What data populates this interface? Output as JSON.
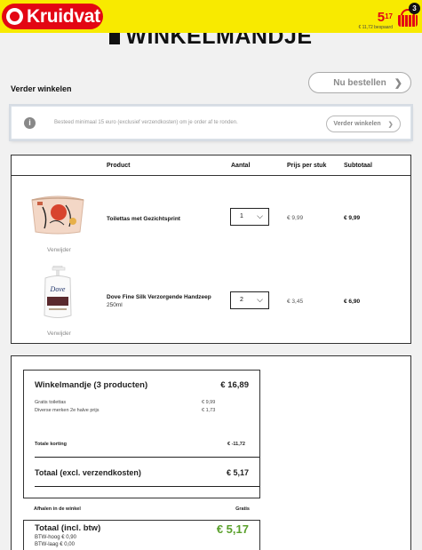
{
  "header": {
    "logo_text": "Kruidvat",
    "price_main": "5",
    "price_cents": "17",
    "saved_text": "€ 11,72 bespaard",
    "basket_count": "3",
    "brand_red": "#e30613",
    "brand_yellow": "#f8ea00"
  },
  "page": {
    "title": "WINKELMANDJE",
    "continue_label": "Verder winkelen",
    "order_button": "Nu bestellen"
  },
  "notice": {
    "text": "Besteed minimaal 15 euro (exclusief verzendkosten) om je order af te ronden.",
    "button": "Verder winkelen"
  },
  "table": {
    "headers": [
      "Product",
      "Aantal",
      "Prijs per stuk",
      "Subtotaal"
    ],
    "rows": [
      {
        "name": "Toilettas met Gezichtsprint",
        "subtitle": "",
        "qty": "1",
        "unit_price": "€ 9,99",
        "subtotal": "€ 9,99",
        "remove": "Verwijder"
      },
      {
        "name": "Dove Fine Silk Verzorgende Handzeep",
        "subtitle": "250ml",
        "qty": "2",
        "unit_price": "€ 3,45",
        "subtotal": "€ 6,90",
        "remove": "Verwijder",
        "product_brand_text": "Dove"
      }
    ]
  },
  "summary": {
    "title": "Winkelmandje (3 producten)",
    "title_total": "€ 16,89",
    "lines": [
      {
        "label": "Gratis toilettas",
        "value": "€ 9,99"
      },
      {
        "label": "Diverse merken 2e halve prijs",
        "value": "€ 1,73"
      }
    ],
    "discount_label": "Totale korting",
    "discount_value": "€ -11,72",
    "excl_label": "Totaal (excl. verzendkosten)",
    "excl_value": "€ 5,17",
    "pickup_label": "Afhalen in de winkel",
    "pickup_value": "Gratis",
    "grand_label": "Totaal (incl. btw)",
    "grand_value": "€ 5,17",
    "vat_high": "BTW-hoog € 0,90",
    "vat_low": "BTW-laag € 0,00",
    "accent_green": "#5aa02c"
  }
}
